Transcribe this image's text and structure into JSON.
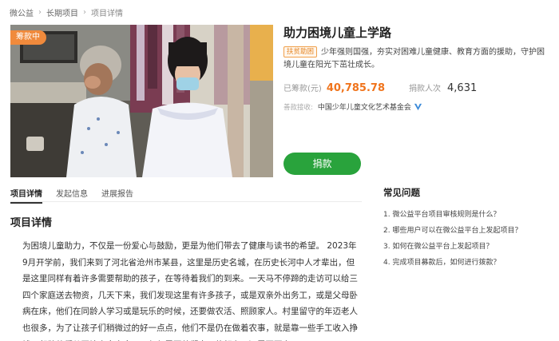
{
  "breadcrumb": [
    "微公益",
    "长期项目",
    "项目详情"
  ],
  "project": {
    "status_tag": "筹款中",
    "title": "助力困境儿童上学路",
    "badge": "扶贫助困",
    "description": "少年强则国强，夯实对困难儿童健康、教育方面的援助，守护困境儿童在阳光下茁壮成长。",
    "raised_label": "已筹款(元)",
    "raised_value": "40,785.78",
    "donors_label": "捐款人次",
    "donors_value": "4,631",
    "receiver_label": "善款接收:",
    "receiver_org": "中国少年儿童文化艺术基金会",
    "donate_label": "捐款"
  },
  "tabs": [
    "项目详情",
    "发起信息",
    "进展报告"
  ],
  "details": {
    "heading": "项目详情",
    "story": "为困境儿童助力，不仅是一份爱心与鼓励，更是为他们带去了健康与读书的希望。 2023年9月开学前，我们来到了河北省沧州市某县，这里是历史名城，在历史长河中人才辈出，但是这里同样有着许多需要帮助的孩子，在等待着我们的到来。一天马不停蹄的走访可以给三四个家庭送去物资，几天下来，我们发现这里有许多孩子，或是双亲外出务工，或是父母卧病在床，他们在同龄人学习或是玩乐的时候，还要做农活、照顾家人。村里留守的年迈老人也很多，为了让孩子们稍微过的好一点点，他们不是仍在做着农事，就是靠一些手工收入挣钱。帮助他们从困境中走出来，不仅仅需要他们自己的努力，还需要更多"
  },
  "faq": {
    "title": "常见问题",
    "items": [
      "1. 微公益平台项目审核规则是什么？",
      "2. 哪些用户可以在微公益平台上发起项目？",
      "3. 如何在微公益平台上发起项目？",
      "4. 完成项目募款后，如何进行拨款？"
    ]
  },
  "colors": {
    "accent": "#f0741c",
    "donate": "#29a33c",
    "tag": "#f08a3c",
    "verify": "#3d8bd9"
  },
  "icons": {
    "verified": "verified-badge-icon"
  }
}
